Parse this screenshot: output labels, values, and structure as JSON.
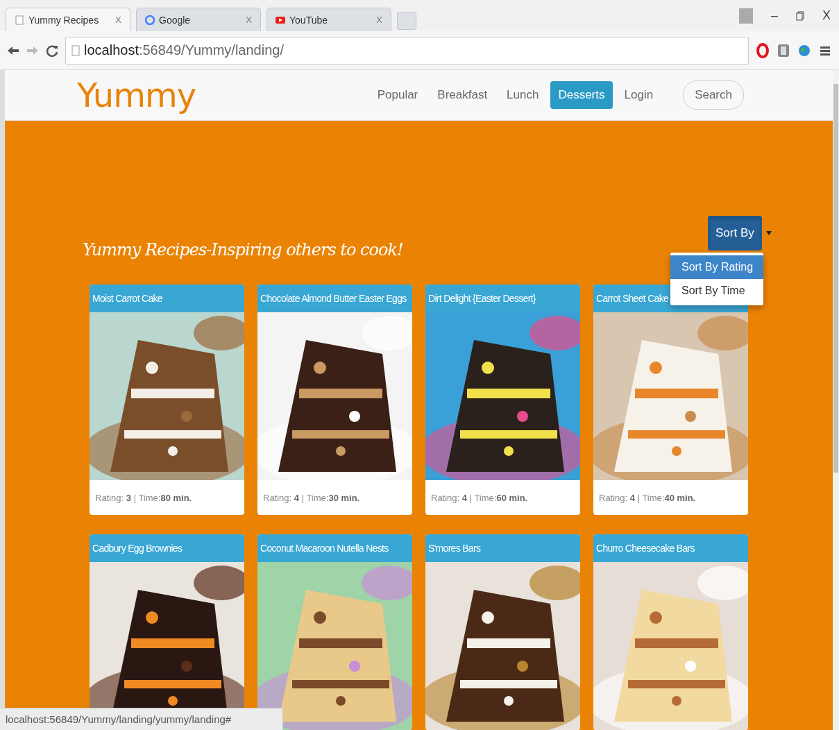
{
  "browser": {
    "tabs": [
      {
        "title": "Yummy Recipes",
        "close": "X",
        "selected": true
      },
      {
        "title": "Google",
        "close": "X",
        "selected": false
      },
      {
        "title": "YouTube",
        "close": "X",
        "selected": false
      }
    ],
    "address": {
      "host": "localhost",
      "path": ":56849/Yummy/landing/"
    },
    "status_url": "localhost:56849/Yummy/landing/yummy/landing#",
    "window_controls": [
      "–",
      "X"
    ]
  },
  "site": {
    "logo": "Yummy",
    "nav": [
      {
        "label": "Popular",
        "selected": false
      },
      {
        "label": "Breakfast",
        "selected": false
      },
      {
        "label": "Lunch",
        "selected": false
      },
      {
        "label": "Desserts",
        "selected": true
      },
      {
        "label": "Login",
        "selected": false
      }
    ],
    "search": "Search"
  },
  "hero": {
    "tagline": "Yummy Recipes-Inspiring others to cook!",
    "sort": {
      "label": "Sort By",
      "expanded": true,
      "options": [
        {
          "label": "Sort By Rating",
          "selected": true
        },
        {
          "label": "Sort By Time",
          "selected": false
        }
      ]
    }
  },
  "recipes": [
    {
      "title": "Moist Carrot Cake",
      "meta": "Rating: **3** | Time:**80 min.**"
    },
    {
      "title": "Chocolate Almond Butter Easter Eggs",
      "meta": "Rating: **4** | Time:**30 min.**"
    },
    {
      "title": "Dirt Delight {Easter Dessert}",
      "meta": "Rating: **4** | Time:**60 min.**"
    },
    {
      "title": "Carrot Sheet Cake",
      "meta": "Rating: **4** | Time:**40 min.**"
    },
    {
      "title": "Cadbury Egg Brownies"
    },
    {
      "title": "Coconut Macaroon Nutella Nests"
    },
    {
      "title": "S'mores Bars"
    },
    {
      "title": "Churro Cheesecake Bars"
    }
  ]
}
